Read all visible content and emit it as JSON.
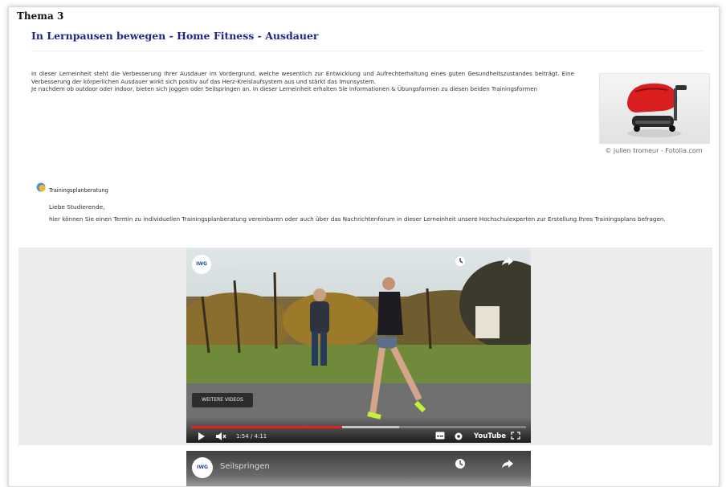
{
  "topic": "Thema 3",
  "lesson": {
    "title": "In Lernpausen bewegen - Home Fitness - Ausdauer"
  },
  "intro": {
    "p1": "In dieser Lerneinheit steht die Verbesserung Ihrer Ausdauer im Vordergrund, welche wesentlich zur Entwicklung und Aufrechterhaltung eines guten Gesundheitszustandes beiträgt. Eine Verbesserung der körperlichen Ausdauer wirkt sich positiv auf das Herz-Kreislaufsystem aus und stärkt das Imunsystem.",
    "p2": "Je nachdem ob outdoor oder indoor, bieten sich Joggen oder Seilspringen an. In dieser Lerneinheit erhalten Sie Informationen & Übungsformen zu diesen beiden Trainingsformen"
  },
  "side_image": {
    "credit": "© julien tromeur - Fotolia.com"
  },
  "training": {
    "link": "Trainingsplanberatung",
    "greeting": "Liebe Studierende,",
    "message": "hier können Sie einen Termin zu individuellen Trainingsplanberatung vereinbaren oder auch über das Nachrichtenforum in dieser Lerneinheit unsere Hochschulexperten zur Erstellung Ihres Trainingsplans befragen."
  },
  "video1": {
    "logo": "IWG",
    "channel": "Laufen",
    "more_button": "WEITERE VIDEOS",
    "time": "1:54 / 4:11",
    "played_fraction": 0.45,
    "buffered_fraction": 0.62,
    "brand": "YouTube",
    "icons": [
      "play-icon",
      "volume-mute-icon",
      "subtitles-icon",
      "settings-gear-icon",
      "fullscreen-icon",
      "watch-later-clock-icon",
      "share-arrow-icon"
    ]
  },
  "video2": {
    "logo": "IWG",
    "title": "Seilspringen"
  },
  "colors": {
    "title_blue": "#23238c",
    "progress_red": "#e5231b",
    "video_bg": "#ececec"
  }
}
